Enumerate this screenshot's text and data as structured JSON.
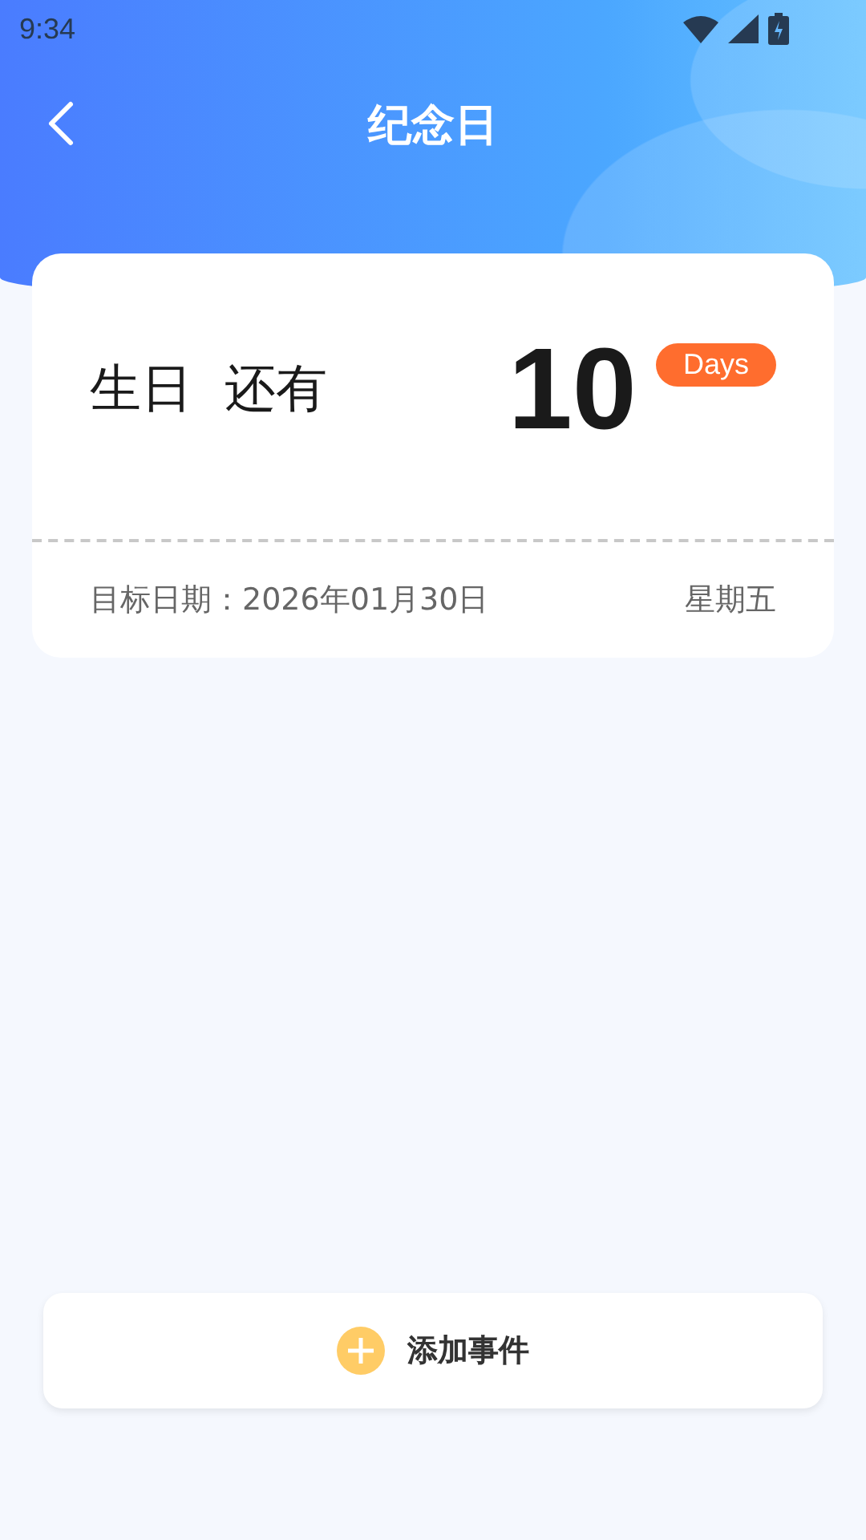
{
  "status_bar": {
    "time": "9:34"
  },
  "header": {
    "title": "纪念日"
  },
  "event": {
    "name": "生日",
    "label": "还有",
    "count": "10",
    "unit": "Days",
    "target_date": "目标日期：2026年01月30日",
    "weekday": "星期五"
  },
  "add_button": {
    "label": "添加事件"
  }
}
